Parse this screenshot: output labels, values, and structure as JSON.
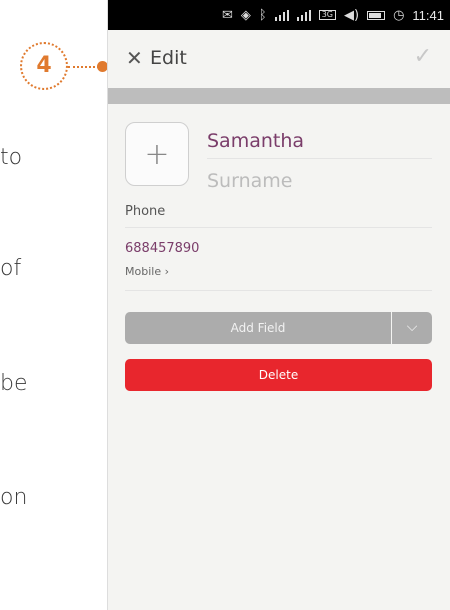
{
  "doc_fragments": [
    "to",
    "of",
    "be",
    "on"
  ],
  "callout": {
    "number": "4",
    "color": "#e07a2e"
  },
  "status_bar": {
    "time": "11:41",
    "network_badge": "3G"
  },
  "header": {
    "title": "Edit"
  },
  "contact": {
    "first_name": "Samantha",
    "surname_placeholder": "Surname",
    "phone_label": "Phone",
    "phone_number": "688457890",
    "phone_type": "Mobile ›"
  },
  "buttons": {
    "add_field": "Add Field",
    "delete": "Delete"
  },
  "colors": {
    "accent": "#7a3d6a",
    "delete": "#e8262d",
    "callout": "#e07a2e"
  },
  "icons": [
    "close-icon",
    "check-icon",
    "plus-icon",
    "chevron-down-icon",
    "message-icon",
    "location-icon",
    "bluetooth-icon",
    "signal-icon",
    "wifi-icon",
    "volume-icon",
    "battery-icon",
    "clock-icon"
  ]
}
